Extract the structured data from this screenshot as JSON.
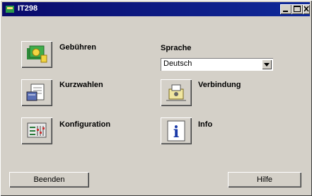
{
  "window": {
    "title": "IT298",
    "icon": "app-icon",
    "controls": [
      "minimize-icon",
      "maximize-icon",
      "close-icon"
    ]
  },
  "buttons": {
    "gebuehren": {
      "label": "Gebühren",
      "icon": "coins-icon"
    },
    "kurzwahlen": {
      "label": "Kurzwahlen",
      "icon": "phonebook-icon"
    },
    "konfiguration": {
      "label": "Konfiguration",
      "icon": "config-icon"
    },
    "verbindung": {
      "label": "Verbindung",
      "icon": "connection-icon"
    },
    "info": {
      "label": "Info",
      "icon": "info-icon",
      "glyph": "i"
    }
  },
  "sprache": {
    "label": "Sprache",
    "selected": "Deutsch"
  },
  "footer": {
    "beenden": "Beenden",
    "hilfe": "Hilfe"
  }
}
